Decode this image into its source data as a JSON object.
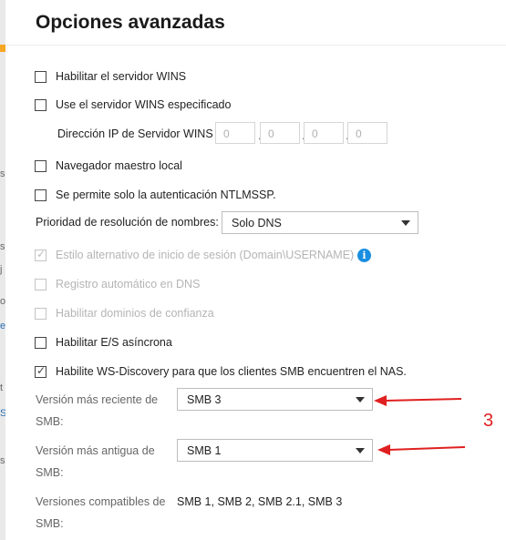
{
  "window": {
    "title": "Opciones avanzadas"
  },
  "options": {
    "wins_server": {
      "label": "Habilitar el servidor WINS",
      "checked": false,
      "enabled": true
    },
    "wins_specified": {
      "label": "Use el servidor WINS especificado",
      "checked": false,
      "enabled": true
    },
    "wins_ip": {
      "label": "Dirección IP de Servidor WINS",
      "octets": [
        "0",
        "0",
        "0",
        "0"
      ]
    },
    "local_master_browser": {
      "label": "Navegador maestro local",
      "checked": false,
      "enabled": true
    },
    "ntlmssp_only": {
      "label": "Se permite solo la autenticación NTLMSSP.",
      "checked": false,
      "enabled": true
    },
    "name_resolution": {
      "label": "Prioridad de resolución de nombres:",
      "selected": "Solo DNS"
    },
    "alt_login_style": {
      "label": "Estilo alternativo de inicio de sesión (Domain\\USERNAME)",
      "checked": true,
      "enabled": false,
      "info_icon": "info-icon"
    },
    "dns_auto_register": {
      "label": "Registro automático en DNS",
      "checked": false,
      "enabled": false
    },
    "trusted_domains": {
      "label": "Habilitar dominios de confianza",
      "checked": false,
      "enabled": false
    },
    "async_io": {
      "label": "Habilitar E/S asíncrona",
      "checked": false,
      "enabled": true
    },
    "ws_discovery": {
      "label": "Habilite WS-Discovery para que los clientes SMB encuentren el NAS.",
      "checked": true,
      "enabled": true
    }
  },
  "smb": {
    "max_version": {
      "label_line1": "Versión más reciente de",
      "label_line2": "SMB:",
      "selected": "SMB 3"
    },
    "min_version": {
      "label_line1": "Versión más antigua de",
      "label_line2": "SMB:",
      "selected": "SMB 1"
    },
    "compatible": {
      "label_line1": "Versiones compatibles de",
      "label_line2": "SMB:",
      "value": "SMB 1, SMB 2, SMB 2.1, SMB 3"
    }
  },
  "annotation": {
    "number": "3",
    "color": "#e02020"
  },
  "left_strip_glyphs": [
    "s",
    "s",
    "j",
    "o",
    "e",
    "t",
    "S",
    "s"
  ],
  "colors": {
    "info_blue": "#1a8ee0",
    "accent_orange": "#f5a623"
  }
}
